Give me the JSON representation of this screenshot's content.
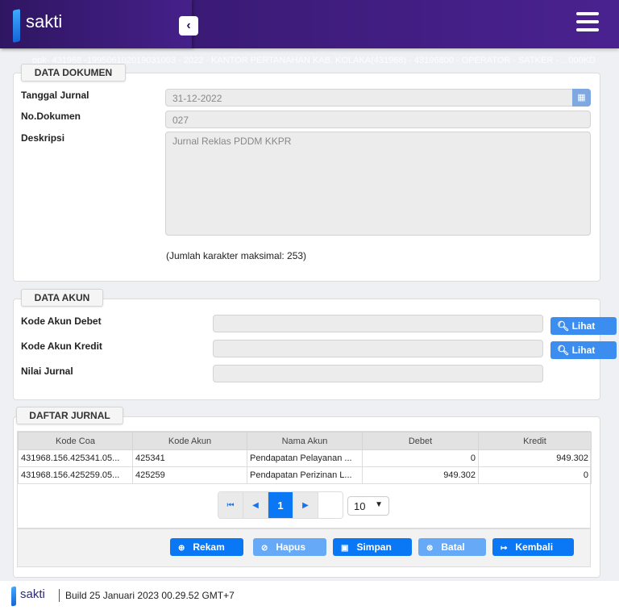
{
  "header": {
    "brand": "sakti",
    "collapse_icon": "chevron-left-icon",
    "menu_icon": "hamburger-icon"
  },
  "subheader": "ppk- 431968 -199506102019031003 - 2022 - KANTOR PERTANAHAN KAB. KOLAKA(431968) - 43196800 - OPERATOR - SATKER - ...000KD",
  "data_dokumen": {
    "legend": "DATA DOKUMEN",
    "tanggal_label": "Tanggal Jurnal",
    "tanggal_value": "31-12-2022",
    "nodok_label": "No.Dokumen",
    "nodok_value": "027",
    "deskripsi_label": "Deskripsi",
    "deskripsi_value": "Jurnal Reklas PDDM KKPR",
    "note": "(Jumlah karakter maksimal: 253)"
  },
  "data_akun": {
    "legend": "DATA AKUN",
    "debet_label": "Kode Akun Debet",
    "kredit_label": "Kode Akun Kredit",
    "nilai_label": "Nilai Jurnal",
    "lihat": "Lihat"
  },
  "daftar_jurnal": {
    "legend": "DAFTAR JURNAL",
    "columns": [
      "Kode Coa",
      "Kode Akun",
      "Nama Akun",
      "Debet",
      "Kredit"
    ],
    "rows": [
      [
        "431968.156.425341.05...",
        "425341",
        "Pendapatan Pelayanan ...",
        "0",
        "949.302"
      ],
      [
        "431968.156.425259.05...",
        "425259",
        "Pendapatan Perizinan L...",
        "949.302",
        "0"
      ]
    ],
    "page": "1",
    "page_size": "10"
  },
  "actions": {
    "rekam": "Rekam",
    "hapus": "Hapus",
    "simpan": "Simpan",
    "batal": "Batal",
    "kembali": "Kembali"
  },
  "footer": {
    "brand": "sakti",
    "build": "Build 25 Januari 2023 00.29.52 GMT+7"
  },
  "colors": {
    "primary": "#0a78f5",
    "header": "#3f1d80"
  }
}
